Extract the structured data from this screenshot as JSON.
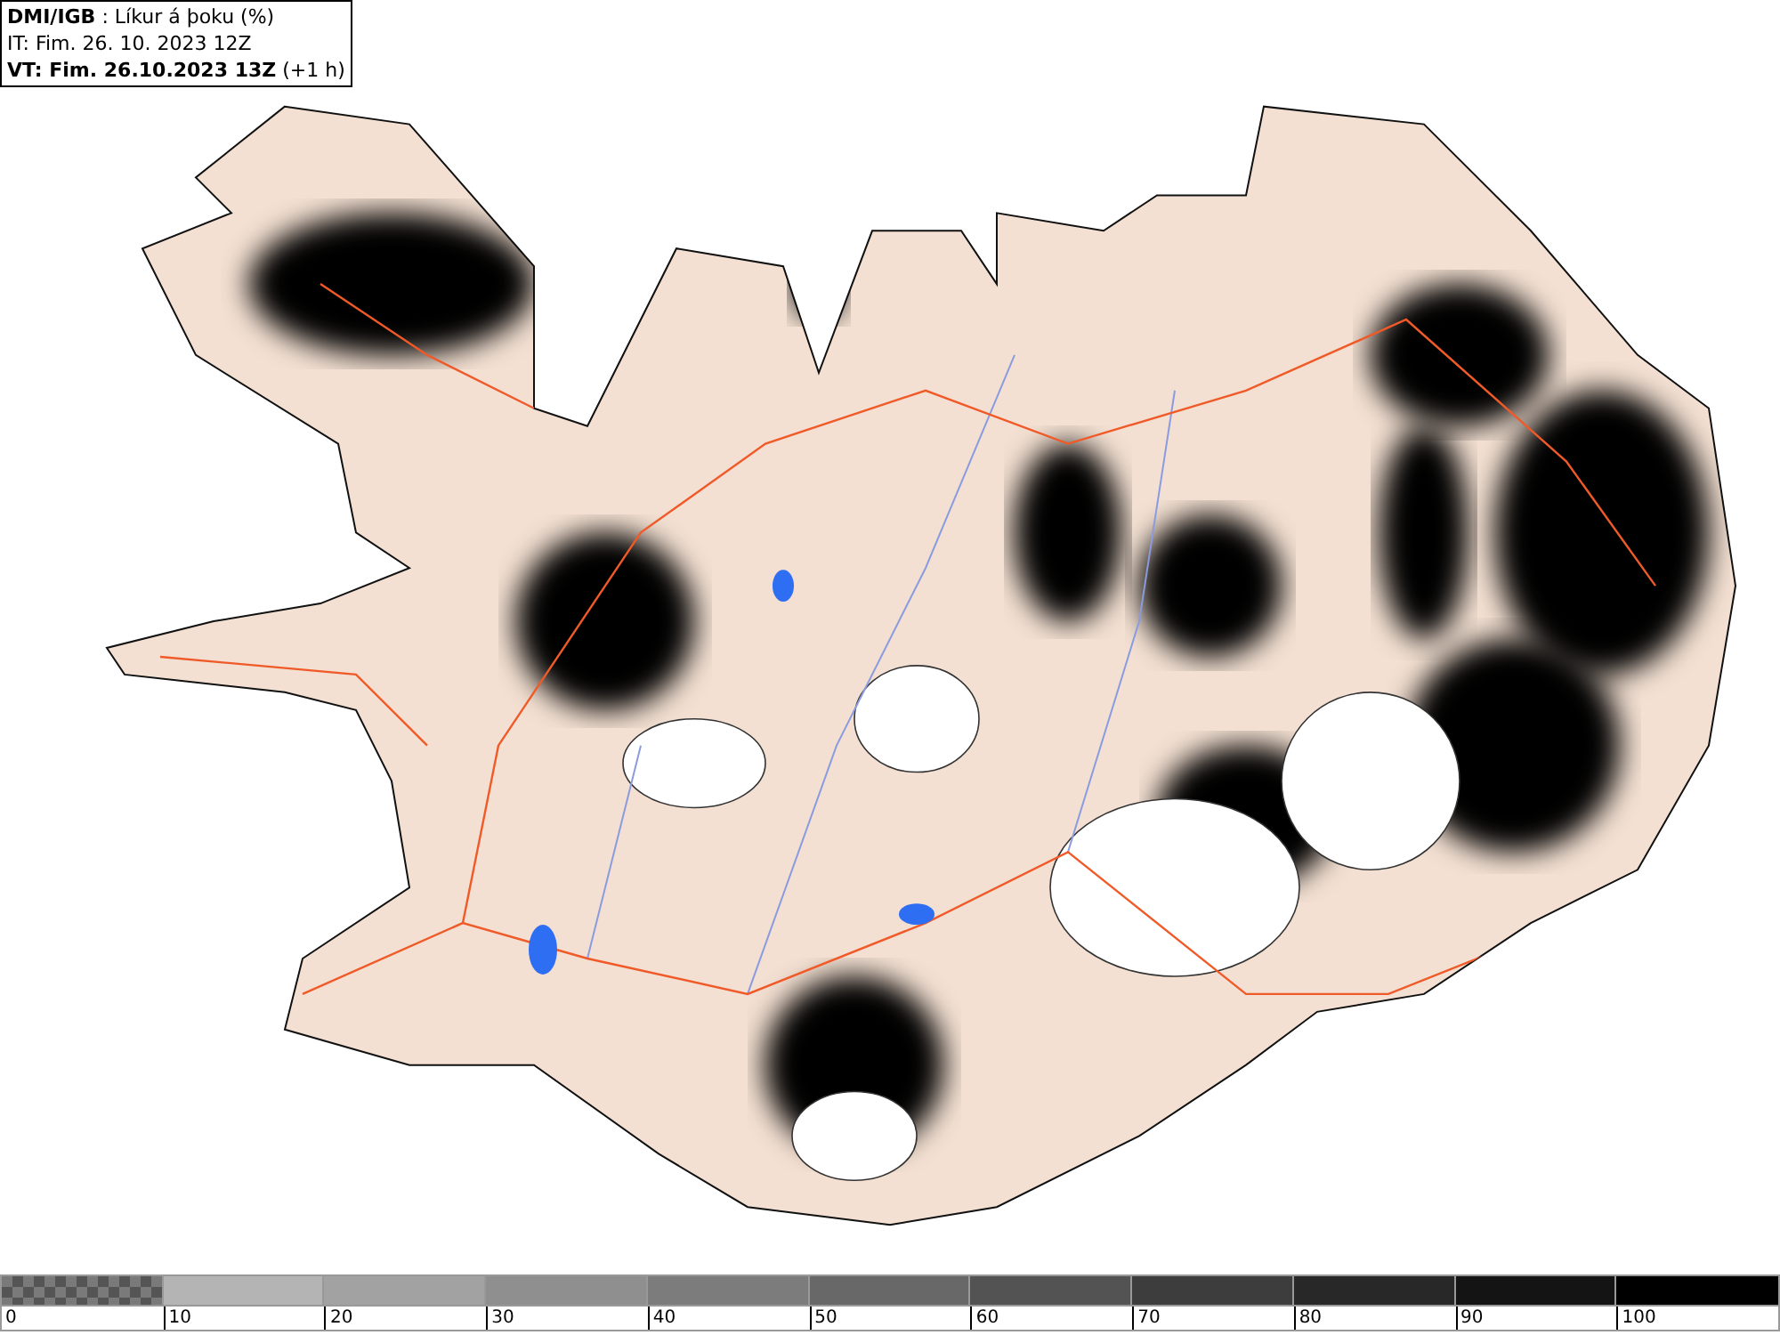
{
  "header": {
    "lines": [
      "**DMI/IGB** : Líkur á þoku (%)",
      "IT: Fim. 26. 10. 2023 12Z",
      "**VT: Fim. 26.10.2023 13Z** (+1 h)"
    ]
  },
  "legend": {
    "segments": [
      {
        "kind": "checkered",
        "color": "#7a7a7a"
      },
      {
        "kind": "solid",
        "color": "#b4b4b4"
      },
      {
        "kind": "solid",
        "color": "#a2a2a2"
      },
      {
        "kind": "solid",
        "color": "#8f8f8f"
      },
      {
        "kind": "solid",
        "color": "#7c7c7c"
      },
      {
        "kind": "solid",
        "color": "#686868"
      },
      {
        "kind": "solid",
        "color": "#535353"
      },
      {
        "kind": "solid",
        "color": "#3d3d3d"
      },
      {
        "kind": "solid",
        "color": "#282828"
      },
      {
        "kind": "solid",
        "color": "#141414"
      },
      {
        "kind": "solid",
        "color": "#000000"
      }
    ],
    "ticks": [
      "0",
      "10",
      "20",
      "30",
      "40",
      "50",
      "60",
      "70",
      "80",
      "90",
      "100"
    ]
  }
}
